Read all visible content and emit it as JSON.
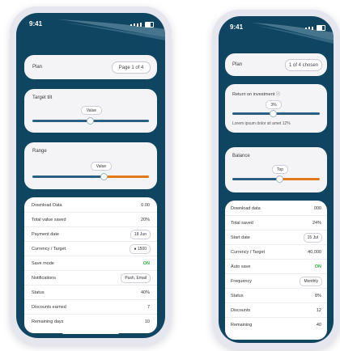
{
  "colors": {
    "screen_bg": "#0f4560",
    "accent_blue": "#2c5f82",
    "accent_orange": "#e07a1a",
    "card_bg": "#f4f4f7",
    "toggle_green": "#2fb24a"
  },
  "phone_left": {
    "status": {
      "time": "9:41"
    },
    "top_card": {
      "label": "Plan",
      "value": "Page 1 of 4"
    },
    "slider_card": {
      "label": "Target tilt",
      "value": "Value"
    },
    "range_card": {
      "label": "Range",
      "value": "Value"
    },
    "settings_rows": [
      {
        "label": "Download Data",
        "value": "0.00"
      },
      {
        "label": "Total value saved",
        "value": "20%"
      },
      {
        "label": "Payment date",
        "value": "18 Jun",
        "type": "pill"
      },
      {
        "label": "Currency / Target",
        "value": "● 1500",
        "type": "pill"
      },
      {
        "label": "Save mode",
        "value": "ON",
        "type": "toggle"
      },
      {
        "label": "Notifications",
        "value": "Push, Email",
        "type": "pill"
      },
      {
        "label": "Status",
        "value": "40%"
      },
      {
        "label": "Discounts earned",
        "value": "7"
      },
      {
        "label": "Remaining days",
        "value": "10"
      }
    ]
  },
  "phone_right": {
    "status": {
      "time": "9:41"
    },
    "top_card": {
      "label": "Plan",
      "value": "1 of 4 chosen"
    },
    "slider_card": {
      "label": "Return on investment ⓘ",
      "value": "3%",
      "caption": "Lorem ipsum dolor sit amet 12%"
    },
    "range_card": {
      "label": "Balance",
      "value": "Top"
    },
    "settings_rows": [
      {
        "label": "Download data",
        "value": "000"
      },
      {
        "label": "Total saved",
        "value": "24%"
      },
      {
        "label": "Start date",
        "value": "15 Jul",
        "type": "pill"
      },
      {
        "label": "Currency / Target",
        "value": "40,000"
      },
      {
        "label": "Auto save",
        "value": "ON",
        "type": "toggle"
      },
      {
        "label": "Frequency",
        "value": "Monthly",
        "type": "pill"
      },
      {
        "label": "Status",
        "value": "8%"
      },
      {
        "label": "Discounts",
        "value": "12"
      },
      {
        "label": "Remaining",
        "value": "40"
      }
    ]
  }
}
